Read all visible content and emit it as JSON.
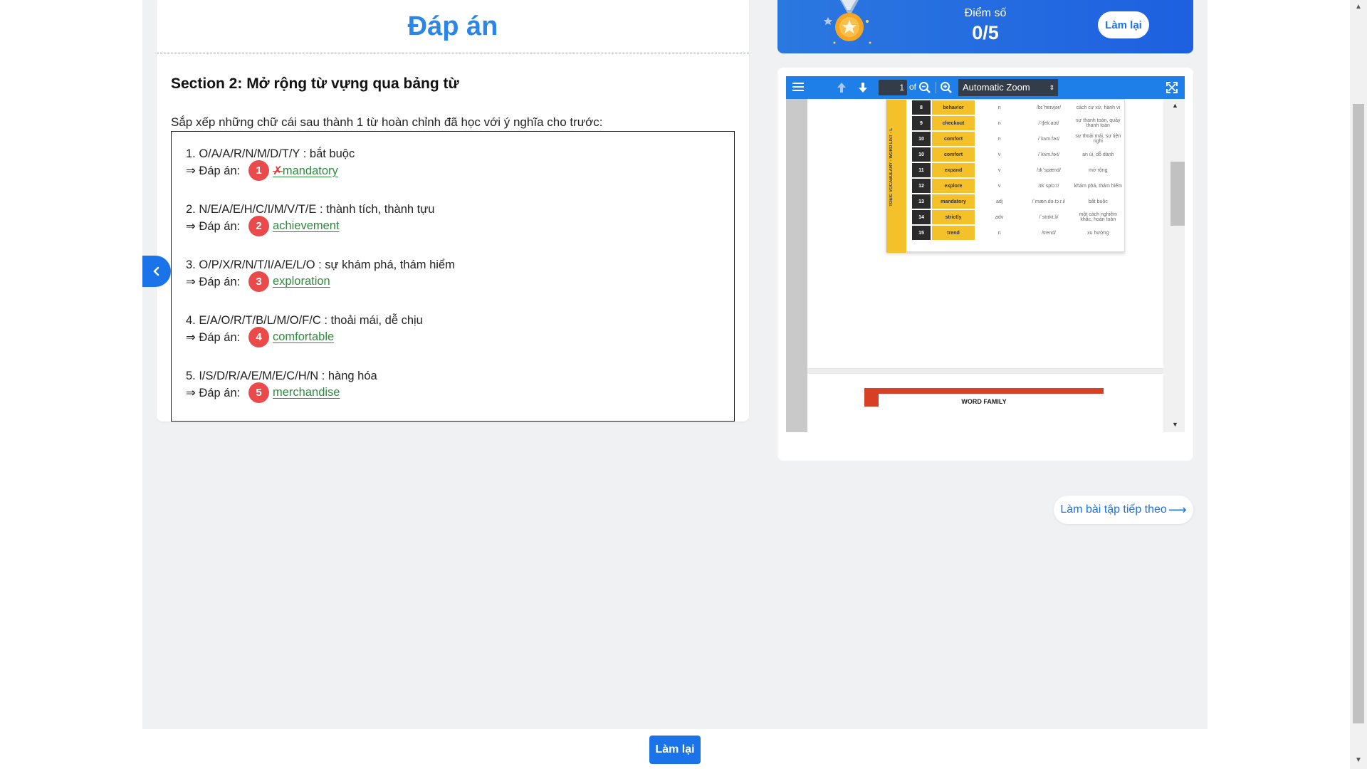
{
  "result": {
    "title": "Đáp án",
    "section_heading": "Section 2: Mở rộng từ vựng qua bảng từ",
    "instruction": "Sắp xếp những chữ cái sau thành 1 từ hoàn chỉnh đã học với ý nghĩa cho trước:",
    "answer_prefix": "⇒ Đáp án:",
    "wrong_mark": "✗",
    "questions": [
      {
        "prompt": "1. O/A/A/R/N/M/D/T/Y : bắt buộc",
        "number": "1",
        "answer": "mandatory"
      },
      {
        "prompt": "2. N/E/A/E/H/C/I/M/V/T/E : thành tích, thành tựu",
        "number": "2",
        "answer": "achievement"
      },
      {
        "prompt": "3. O/P/X/R/N/T/I/A/E/L/O : sự khám phá, thám hiểm",
        "number": "3",
        "answer": "exploration"
      },
      {
        "prompt": "4. E/A/O/R/T/B/L/M/O/F/C : thoải mái, dễ chịu",
        "number": "4",
        "answer": "comfortable"
      },
      {
        "prompt": "5. I/S/D/R/A/E/M/E/C/H/N : hàng hóa",
        "number": "5",
        "answer": "merchandise"
      }
    ]
  },
  "score": {
    "label": "Điểm số",
    "value": "0/5",
    "retry_label": "Làm lại"
  },
  "pdf": {
    "page_number": "1",
    "page_of": "of",
    "zoom": "Automatic Zoom",
    "vocab_rows": [
      {
        "num": "8",
        "word": "behavior",
        "pos": "n",
        "ipa": "/bɪˈheɪvjər/",
        "meaning": "cách cư xử, hành vi"
      },
      {
        "num": "9",
        "word": "checkout",
        "pos": "n",
        "ipa": "/ˈtʃek.aʊt/",
        "meaning": "sự thanh toán, quầy thanh toán"
      },
      {
        "num": "10",
        "word": "comfort",
        "pos": "n",
        "ipa": "/ˈkʌm.fɚt/",
        "meaning": "sự thoải mái, sự tiện nghi"
      },
      {
        "num": "10",
        "word": "comfort",
        "pos": "v",
        "ipa": "/ˈkʌm.fɚt/",
        "meaning": "an ủi, dỗ dành"
      },
      {
        "num": "11",
        "word": "expand",
        "pos": "v",
        "ipa": "/ɪkˈspænd/",
        "meaning": "mở rộng"
      },
      {
        "num": "12",
        "word": "explore",
        "pos": "v",
        "ipa": "/ɪkˈsplɔːr/",
        "meaning": "khám phá, thám hiểm"
      },
      {
        "num": "13",
        "word": "mandatory",
        "pos": "adj",
        "ipa": "/ˈmæn.də.tɔːr.i/",
        "meaning": "bắt buộc"
      },
      {
        "num": "14",
        "word": "strictly",
        "pos": "adv",
        "ipa": "/ˈstrɪkt.li/",
        "meaning": "một cách nghiêm khắc, hoàn toàn"
      },
      {
        "num": "15",
        "word": "trend",
        "pos": "n",
        "ipa": "/trend/",
        "meaning": "xu hướng"
      }
    ],
    "side_label": "TOEIC VOCABULARY - WORD LIST - L",
    "next_page_heading": "WORD FAMILY"
  },
  "actions": {
    "next_exercise": "Làm bài tập tiếp theo",
    "retry_bottom": "Làm lại"
  }
}
